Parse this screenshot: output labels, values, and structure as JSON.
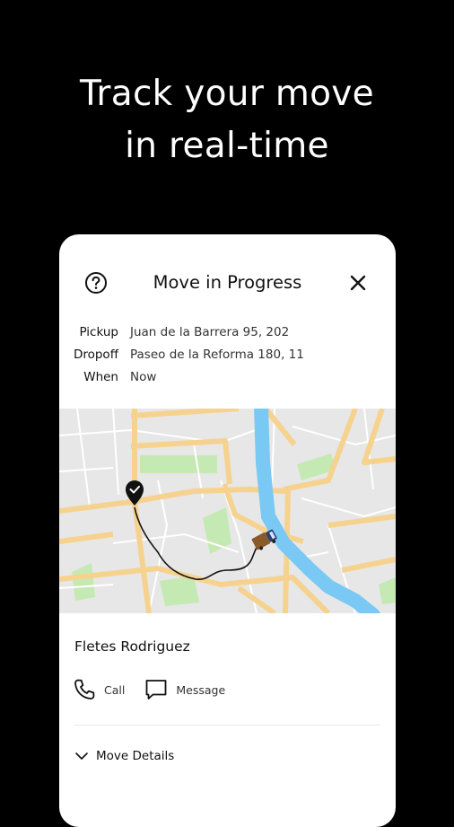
{
  "hero": {
    "line1": "Track your move",
    "line2": "in real-time"
  },
  "card": {
    "title": "Move in Progress",
    "details": [
      {
        "label": "Pickup",
        "value": "Juan de la Barrera 95, 202"
      },
      {
        "label": "Dropoff",
        "value": "Paseo de la Reforma 180, 11"
      },
      {
        "label": "When",
        "value": "Now"
      }
    ],
    "company": "Fletes Rodriguez",
    "actions": {
      "call": "Call",
      "message": "Message"
    },
    "move_details": "Move Details"
  },
  "icons": {
    "help": "question-circle-icon",
    "close": "close-x-icon",
    "phone": "phone-icon",
    "message": "chat-bubble-icon",
    "chevron": "chevron-down-icon",
    "destination": "check-pin-icon",
    "truck": "truck-icon"
  },
  "colors": {
    "background": "#000000",
    "card": "#ffffff",
    "river": "#79c9f4",
    "road": "#f6d28f",
    "park": "#c5e9b3",
    "map_bg": "#e7e7e7"
  }
}
